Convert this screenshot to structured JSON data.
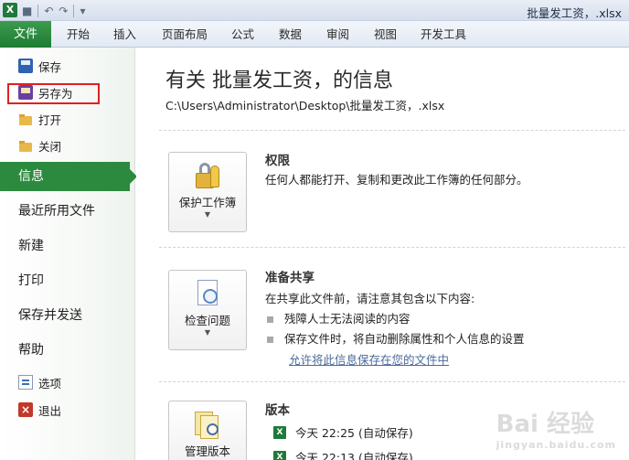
{
  "window": {
    "title": "批量发工资，.xlsx"
  },
  "qat": {
    "undo": "↶",
    "redo": "↷",
    "customize": "▾"
  },
  "ribbon": {
    "file_tab": "文件",
    "tabs": [
      "开始",
      "插入",
      "页面布局",
      "公式",
      "数据",
      "审阅",
      "视图",
      "开发工具"
    ]
  },
  "nav": {
    "small_items": [
      {
        "label": "保存",
        "icon": "save-icon"
      },
      {
        "label": "另存为",
        "icon": "save-as-icon"
      },
      {
        "label": "打开",
        "icon": "open-folder-icon"
      },
      {
        "label": "关闭",
        "icon": "close-folder-icon"
      }
    ],
    "big_items": [
      "信息",
      "最近所用文件",
      "新建",
      "打印",
      "保存并发送",
      "帮助"
    ],
    "active": "信息",
    "bottom_items": [
      {
        "label": "选项",
        "icon": "options-icon"
      },
      {
        "label": "退出",
        "icon": "exit-icon"
      }
    ]
  },
  "info": {
    "title": "有关 批量发工资，的信息",
    "path": "C:\\Users\\Administrator\\Desktop\\批量发工资，.xlsx",
    "permissions": {
      "button_label": "保护工作簿",
      "heading": "权限",
      "text": "任何人都能打开、复制和更改此工作簿的任何部分。"
    },
    "prepare": {
      "button_label": "检查问题",
      "heading": "准备共享",
      "text": "在共享此文件前，请注意其包含以下内容:",
      "bullets": [
        "残障人士无法阅读的内容",
        "保存文件时，将自动删除属性和个人信息的设置"
      ],
      "link": "允许将此信息保存在您的文件中"
    },
    "versions": {
      "button_label": "管理版本",
      "heading": "版本",
      "rows": [
        "今天 22:25 (自动保存)",
        "今天 22:13 (自动保存)"
      ]
    }
  },
  "watermark": {
    "main": "Bai 经验",
    "sub": "jingyan.baidu.com"
  },
  "colors": {
    "accent": "#2b8a3e",
    "highlight": "#e02020"
  }
}
